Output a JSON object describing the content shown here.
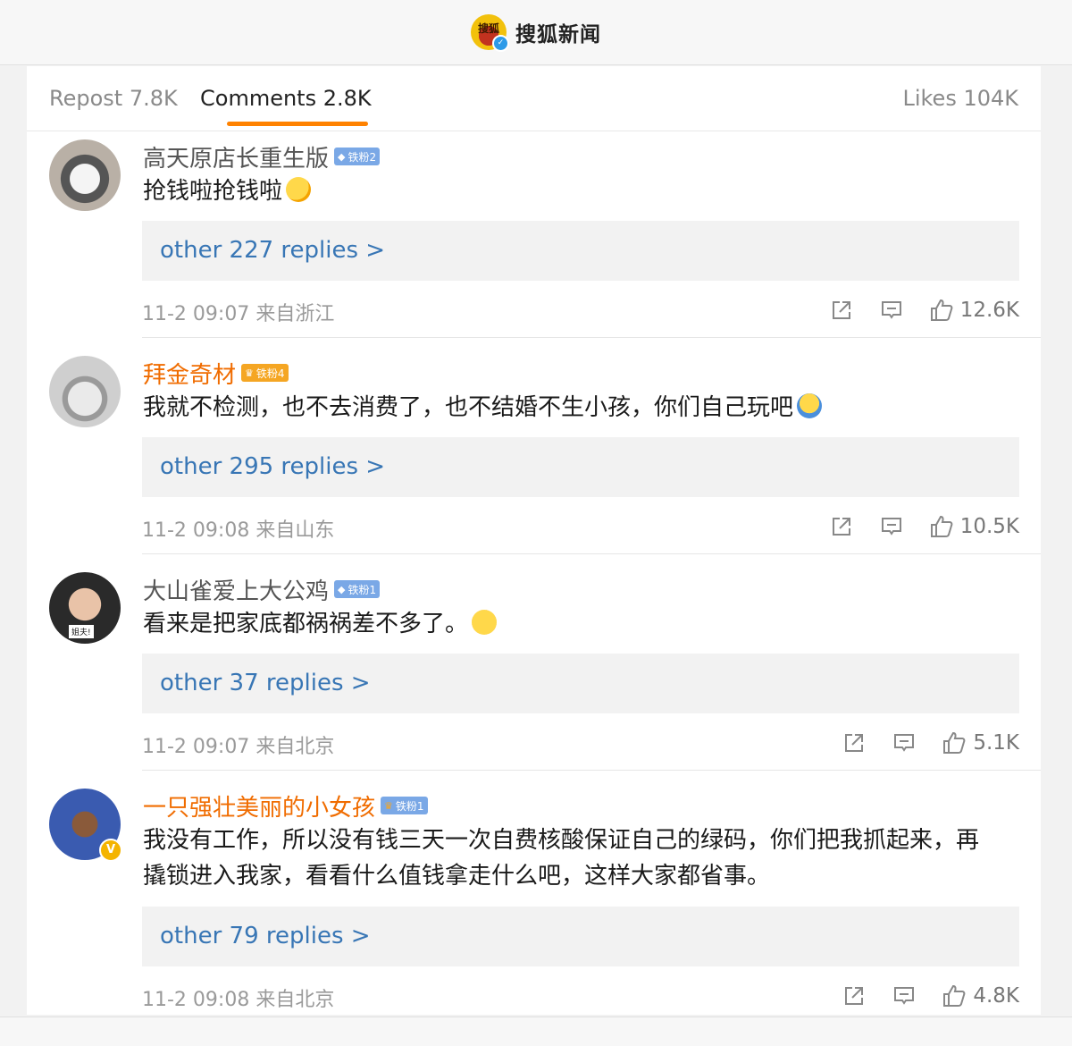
{
  "header": {
    "brand_name": "搜狐新闻",
    "logo_text": "搜狐"
  },
  "tabs": {
    "repost": "Repost 7.8K",
    "comments": "Comments 2.8K",
    "likes": "Likes 104K"
  },
  "comments": [
    {
      "username": "高天原店长重生版",
      "fan_badge": "铁粉2",
      "text": "抢钱啦抢钱啦",
      "replies": "other 227 replies >",
      "meta": "11-2 09:07 来自浙江",
      "likes": "12.6K"
    },
    {
      "username": "拜金奇材",
      "fan_badge": "铁粉4",
      "text": "我就不检测，也不去消费了，也不结婚不生小孩，你们自己玩吧",
      "replies": "other 295 replies >",
      "meta": "11-2 09:08 来自山东",
      "likes": "10.5K"
    },
    {
      "username": "大山雀爱上大公鸡",
      "fan_badge": "铁粉1",
      "text": "看来是把家底都祸祸差不多了。",
      "replies": "other 37 replies >",
      "meta": "11-2 09:07 来自北京",
      "likes": "5.1K",
      "avatar_caption": "姐夫!"
    },
    {
      "username": "一只强壮美丽的小女孩",
      "fan_badge": "铁粉1",
      "text": "我没有工作，所以没有钱三天一次自费核酸保证自己的绿码，你们把我抓起来，再撬锁进入我家，看看什么值钱拿走什么吧，这样大家都省事。",
      "replies": "other 79 replies >",
      "meta": "11-2 09:08 来自北京",
      "likes": "4.8K",
      "avatar_badge": "V"
    }
  ],
  "colors": {
    "accent": "#ff8200",
    "link": "#3876b5",
    "username_vip": "#f06c00"
  }
}
